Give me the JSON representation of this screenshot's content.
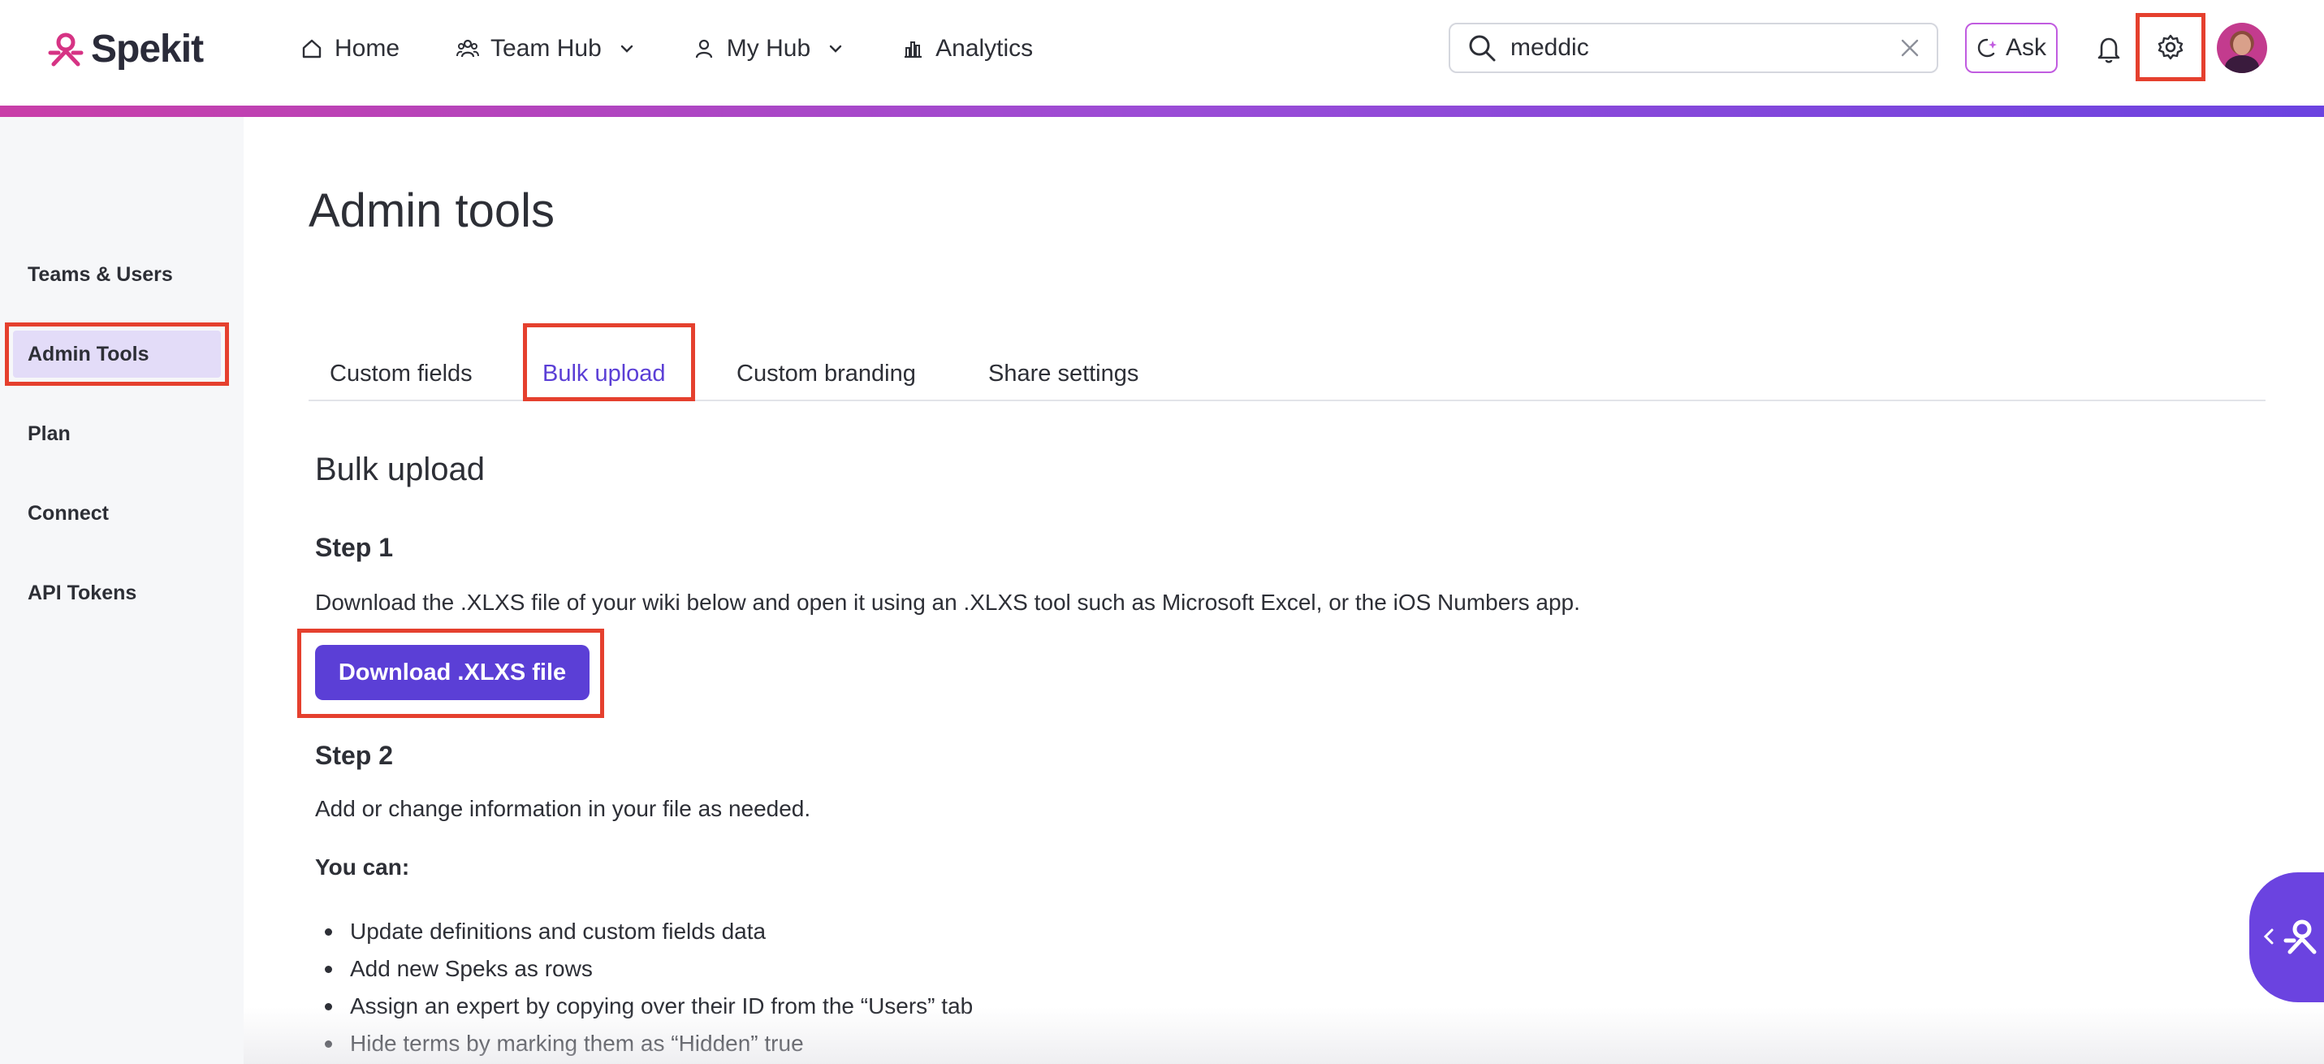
{
  "brand": {
    "name": "Spekit",
    "color": "#d63384"
  },
  "nav": {
    "items": [
      {
        "label": "Home",
        "icon": "home-icon",
        "has_dropdown": false
      },
      {
        "label": "Team Hub",
        "icon": "team-icon",
        "has_dropdown": true
      },
      {
        "label": "My Hub",
        "icon": "person-icon",
        "has_dropdown": true
      },
      {
        "label": "Analytics",
        "icon": "bar-chart-icon",
        "has_dropdown": false
      }
    ]
  },
  "search": {
    "value": "meddic",
    "icon": "search-icon",
    "clear_icon": "close-icon"
  },
  "ask": {
    "label": "Ask",
    "icon": "sparkle-chat-icon"
  },
  "header_icons": {
    "bell": "bell-icon",
    "settings": "gear-icon",
    "avatar": "avatar"
  },
  "colors": {
    "accent": "#5b3fd6",
    "highlight": "#e5402e",
    "active_bg": "#e3dcf8"
  },
  "sidebar": {
    "items": [
      {
        "label": "Teams & Users",
        "active": false
      },
      {
        "label": "Admin Tools",
        "active": true
      },
      {
        "label": "Plan",
        "active": false
      },
      {
        "label": "Connect",
        "active": false
      },
      {
        "label": "API Tokens",
        "active": false
      }
    ]
  },
  "main": {
    "title": "Admin tools",
    "tabs": [
      {
        "label": "Custom fields",
        "active": false
      },
      {
        "label": "Bulk upload",
        "active": true
      },
      {
        "label": "Custom branding",
        "active": false
      },
      {
        "label": "Share settings",
        "active": false
      }
    ],
    "section_title": "Bulk upload",
    "step1": {
      "title": "Step 1",
      "text": "Download the .XLXS file of your wiki below and open it using an .XLXS tool such as Microsoft Excel, or the iOS Numbers app.",
      "button": "Download .XLXS file"
    },
    "step2": {
      "title": "Step 2",
      "text": "Add or change information in your file as needed.",
      "you_can": "You can:",
      "bullets": [
        "Update definitions and custom fields data",
        "Add new Speks as rows",
        "Assign an expert by copying over their ID from the “Users” tab",
        "Hide terms by marking them as “Hidden” true"
      ]
    }
  },
  "widget": {
    "arrow": "chevron-left-icon",
    "logo": "spekit-logo-icon"
  }
}
